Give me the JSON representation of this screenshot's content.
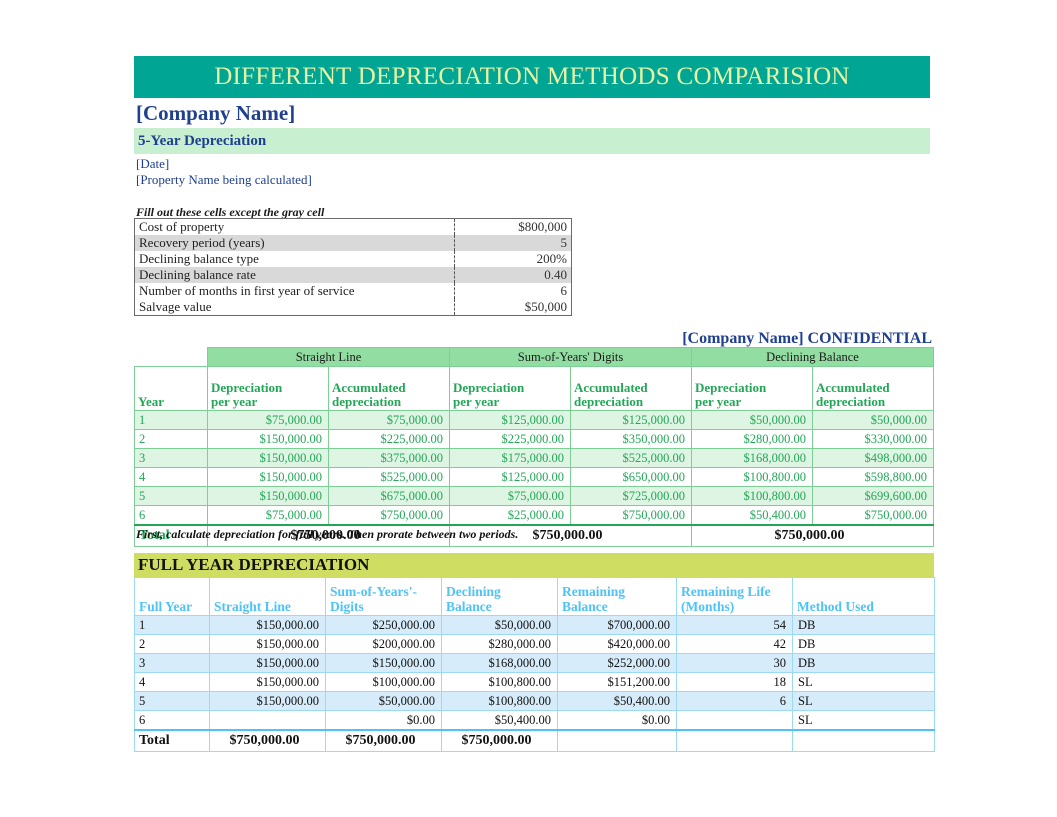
{
  "title_banner": "DIFFERENT DEPRECIATION METHODS COMPARISION",
  "company_name": "[Company Name]",
  "subtitle": "5-Year Depreciation",
  "date_placeholder": "[Date]",
  "property_placeholder": "[Property Name being calculated]",
  "hint": "Fill out these cells except the gray cell",
  "confidential": "[Company Name]  CONFIDENTIAL",
  "note": "First, calculate depreciation for full years.  Then prorate between two periods.",
  "colors": {
    "title_bg": "#00A693",
    "title_fg": "#E9F2A4",
    "band_green": "#C9EFD1",
    "group_green": "#92DDA1",
    "row_green": "#DDF5E2",
    "green_text": "#23A757",
    "navy_text": "#1F3F8F",
    "fy_banner": "#CFDD62",
    "sky_blue": "#4FC3F7",
    "row_blue": "#D7ECFA",
    "gray_cell": "#D9D9D9"
  },
  "params": {
    "rows": [
      {
        "label": "Cost of property",
        "value": "$800,000",
        "gray": false
      },
      {
        "label": "Recovery period (years)",
        "value": "5",
        "gray": true
      },
      {
        "label": "Declining balance type",
        "value": "200%",
        "gray": false
      },
      {
        "label": "Declining balance rate",
        "value": "0.40",
        "gray": true
      },
      {
        "label": "Number of months in first year of service",
        "value": "6",
        "gray": false
      },
      {
        "label": "Salvage value",
        "value": "$50,000",
        "gray": false
      }
    ]
  },
  "comparison": {
    "groups": [
      "Straight Line",
      "Sum-of-Years' Digits",
      "Declining Balance"
    ],
    "year_header": "Year",
    "sub_headers": [
      "Depreciation per year",
      "Accumulated depreciation"
    ],
    "sub_header_line1": "Depreciation",
    "sub_header_line2": "per year",
    "sub_header2_line1": "Accumulated",
    "sub_header2_line2": "depreciation",
    "rows": [
      {
        "year": "1",
        "sl_dep": "$75,000.00",
        "sl_acc": "$75,000.00",
        "syd_dep": "$125,000.00",
        "syd_acc": "$125,000.00",
        "db_dep": "$50,000.00",
        "db_acc": "$50,000.00"
      },
      {
        "year": "2",
        "sl_dep": "$150,000.00",
        "sl_acc": "$225,000.00",
        "syd_dep": "$225,000.00",
        "syd_acc": "$350,000.00",
        "db_dep": "$280,000.00",
        "db_acc": "$330,000.00"
      },
      {
        "year": "3",
        "sl_dep": "$150,000.00",
        "sl_acc": "$375,000.00",
        "syd_dep": "$175,000.00",
        "syd_acc": "$525,000.00",
        "db_dep": "$168,000.00",
        "db_acc": "$498,000.00"
      },
      {
        "year": "4",
        "sl_dep": "$150,000.00",
        "sl_acc": "$525,000.00",
        "syd_dep": "$125,000.00",
        "syd_acc": "$650,000.00",
        "db_dep": "$100,800.00",
        "db_acc": "$598,800.00"
      },
      {
        "year": "5",
        "sl_dep": "$150,000.00",
        "sl_acc": "$675,000.00",
        "syd_dep": "$75,000.00",
        "syd_acc": "$725,000.00",
        "db_dep": "$100,800.00",
        "db_acc": "$699,600.00"
      },
      {
        "year": "6",
        "sl_dep": "$75,000.00",
        "sl_acc": "$750,000.00",
        "syd_dep": "$25,000.00",
        "syd_acc": "$750,000.00",
        "db_dep": "$50,400.00",
        "db_acc": "$750,000.00"
      }
    ],
    "total": {
      "label": "Total",
      "sl": "$750,000.00",
      "syd": "$750,000.00",
      "db": "$750,000.00"
    }
  },
  "full_year": {
    "banner": "FULL YEAR DEPRECIATION",
    "headers": {
      "year": "Full Year",
      "straight_line": "Straight Line",
      "syd_line1": "Sum-of-Years'-",
      "syd_line2": "Digits",
      "db_line1": "Declining",
      "db_line2": "Balance",
      "rb_line1": "Remaining",
      "rb_line2": "Balance",
      "rl_line1": "Remaining Life",
      "rl_line2": "(Months)",
      "method": "Method Used"
    },
    "rows": [
      {
        "year": "1",
        "sl": "$150,000.00",
        "syd": "$250,000.00",
        "db": "$50,000.00",
        "rb": "$700,000.00",
        "rl": "54",
        "method": "DB"
      },
      {
        "year": "2",
        "sl": "$150,000.00",
        "syd": "$200,000.00",
        "db": "$280,000.00",
        "rb": "$420,000.00",
        "rl": "42",
        "method": "DB"
      },
      {
        "year": "3",
        "sl": "$150,000.00",
        "syd": "$150,000.00",
        "db": "$168,000.00",
        "rb": "$252,000.00",
        "rl": "30",
        "method": "DB"
      },
      {
        "year": "4",
        "sl": "$150,000.00",
        "syd": "$100,000.00",
        "db": "$100,800.00",
        "rb": "$151,200.00",
        "rl": "18",
        "method": "SL"
      },
      {
        "year": "5",
        "sl": "$150,000.00",
        "syd": "$50,000.00",
        "db": "$100,800.00",
        "rb": "$50,400.00",
        "rl": "6",
        "method": "SL"
      },
      {
        "year": "6",
        "sl": "",
        "syd": "$0.00",
        "db": "$50,400.00",
        "rb": "$0.00",
        "rl": "",
        "method": "SL"
      }
    ],
    "total": {
      "label": "Total",
      "sl": "$750,000.00",
      "syd": "$750,000.00",
      "db": "$750,000.00"
    }
  }
}
